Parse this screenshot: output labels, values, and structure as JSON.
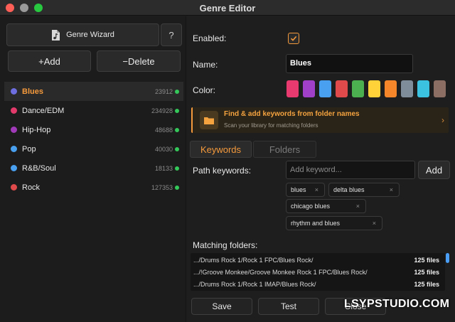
{
  "window": {
    "title": "Genre Editor"
  },
  "left_panel": {
    "wizard_label": "Genre Wizard",
    "help_label": "?",
    "add_label": "+Add",
    "delete_label": "−Delete",
    "genres": [
      {
        "name": "Blues",
        "count": "23912",
        "color": "#6e6ee0",
        "selected": true
      },
      {
        "name": "Dance/EDM",
        "count": "234928",
        "color": "#e23a6a",
        "selected": false
      },
      {
        "name": "Hip-Hop",
        "count": "48688",
        "color": "#a03ab8",
        "selected": false
      },
      {
        "name": "Pop",
        "count": "40030",
        "color": "#4aa0f0",
        "selected": false
      },
      {
        "name": "R&B/Soul",
        "count": "18133",
        "color": "#4aa0f0",
        "selected": false
      },
      {
        "name": "Rock",
        "count": "127353",
        "color": "#e04a4a",
        "selected": false
      }
    ]
  },
  "form": {
    "enabled_label": "Enabled:",
    "enabled_checked": true,
    "name_label": "Name:",
    "name_value": "Blues",
    "color_label": "Color:",
    "swatches": [
      "#e83a6e",
      "#a040c8",
      "#4aa0f0",
      "#e04a4a",
      "#4caf50",
      "#ffd23a",
      "#f5862a",
      "#7f8c9a",
      "#3ac2e0",
      "#8d6e63"
    ]
  },
  "banner": {
    "title": "Find & add keywords from folder names",
    "subtitle": "Scan your library for matching folders"
  },
  "tabs": {
    "keywords": "Keywords",
    "folders": "Folders"
  },
  "keywords": {
    "label": "Path keywords:",
    "placeholder": "Add keyword...",
    "add_label": "Add",
    "tags": [
      "blues",
      "delta blues",
      "chicago blues",
      "rhythm and blues"
    ]
  },
  "matching": {
    "label": "Matching folders:",
    "rows": [
      {
        "path": ".../Drums Rock 1/Rock 1 FPC/Blues Rock/",
        "files": "125 files"
      },
      {
        "path": ".../!Groove Monkee/Groove Monkee Rock 1 FPC/Blues Rock/",
        "files": "125 files"
      },
      {
        "path": ".../Drums Rock 1/Rock 1 IMAP/Blues Rock/",
        "files": "125 files"
      }
    ]
  },
  "footer": {
    "save_label": "Save",
    "test_label": "Test",
    "close_label": "Close"
  },
  "watermark": "LSYPSTUDIO.COM"
}
